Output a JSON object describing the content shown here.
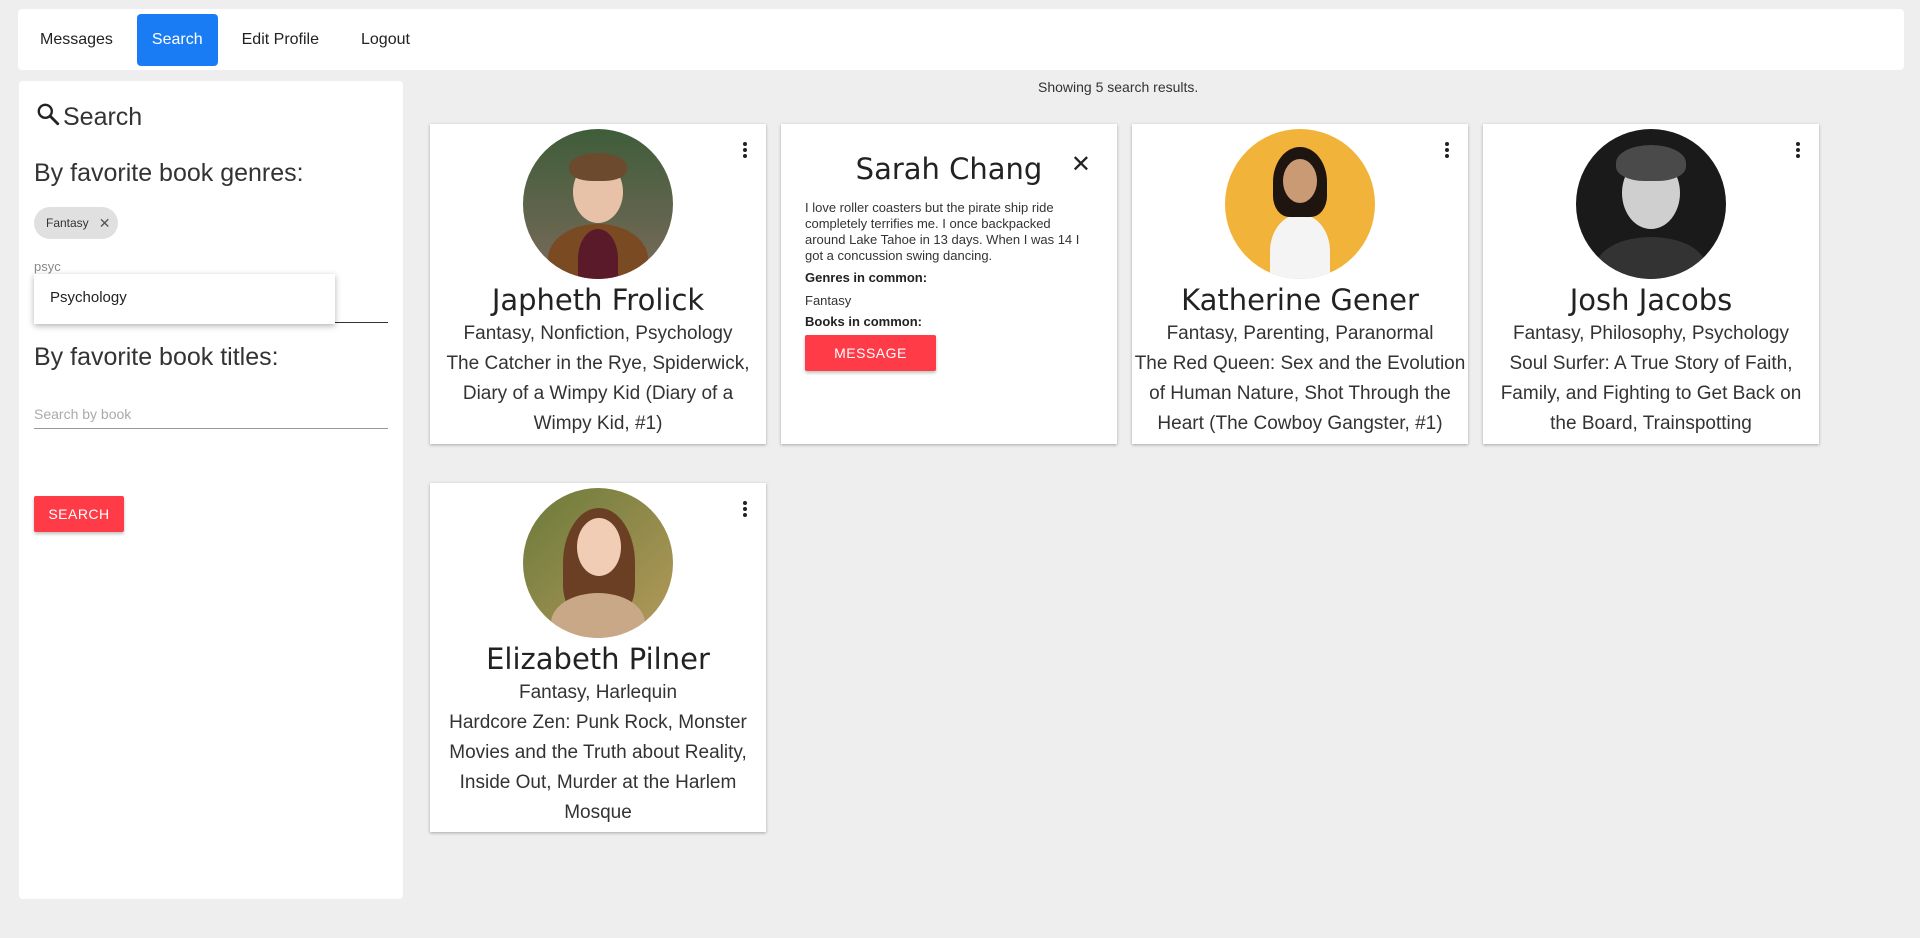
{
  "nav": {
    "items": [
      {
        "label": "Messages",
        "active": false
      },
      {
        "label": "Search",
        "active": true
      },
      {
        "label": "Edit Profile",
        "active": false
      },
      {
        "label": "Logout",
        "active": false
      }
    ]
  },
  "sidebar": {
    "heading": "Search",
    "genres_title": "By favorite book genres:",
    "selected_genre_chip": "Fantasy",
    "genre_input_value": "psyc",
    "suggestion": "Psychology",
    "titles_title": "By favorite book titles:",
    "book_placeholder": "Search by book",
    "search_button": "SEARCH"
  },
  "results": {
    "count_text": "Showing 5 search results.",
    "cards": [
      {
        "name": "Japheth Frolick",
        "genres": "Fantasy, Nonfiction, Psychology",
        "books": "The Catcher in the Rye, Spiderwick, Diary of a Wimpy Kid (Diary of a Wimpy Kid, #1)"
      },
      {
        "name": "Sarah Chang",
        "bio": "I love roller coasters but the pirate ship ride completely terrifies me. I once backpacked around Lake Tahoe in 13 days. When I was 14 I got a concussion swing dancing.",
        "genres_label": "Genres in common:",
        "genres_common": "Fantasy",
        "books_label": "Books in common:",
        "message_button": "MESSAGE"
      },
      {
        "name": "Katherine Gener",
        "genres": "Fantasy, Parenting, Paranormal",
        "books": "The Red Queen: Sex and the Evolution of Human Nature, Shot Through the Heart (The Cowboy Gangster, #1)"
      },
      {
        "name": "Josh Jacobs",
        "genres": "Fantasy, Philosophy, Psychology",
        "books": "Soul Surfer: A True Story of Faith, Family, and Fighting to Get Back on the Board, Trainspotting"
      },
      {
        "name": "Elizabeth Pilner",
        "genres": "Fantasy, Harlequin",
        "books": "Hardcore Zen: Punk Rock, Monster Movies and the Truth about Reality, Inside Out, Murder at the Harlem Mosque"
      }
    ]
  },
  "colors": {
    "accent_blue": "#1a7cf5",
    "action_red": "#ff3b47",
    "background": "#eeeeee"
  }
}
